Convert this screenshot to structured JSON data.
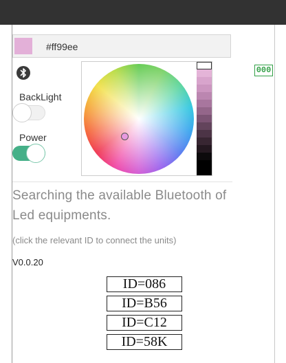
{
  "color": {
    "hex": "#ff99ee",
    "swatch_color": "#e3b0d8"
  },
  "bluetooth": {
    "icon": "bluetooth-icon"
  },
  "backlight": {
    "label": "BackLight",
    "on": false
  },
  "power": {
    "label": "Power",
    "on": true
  },
  "badge": {
    "text": "000",
    "color": "#32a046"
  },
  "ramp": [
    "#ffffff",
    "#e4b4d8",
    "#d8a4cc",
    "#cc96c0",
    "#bb86b0",
    "#a8769e",
    "#94668a",
    "#7c5474",
    "#63445c",
    "#4c3446",
    "#382632",
    "#241820",
    "#0c0a0c",
    "#000000"
  ],
  "status": {
    "searching": "Searching the available Bluetooth of Led equipments.",
    "hint": "(click the relevant ID to connect the units)",
    "version": "V0.0.20"
  },
  "devices": [
    {
      "label": "ID=086"
    },
    {
      "label": "ID=B56"
    },
    {
      "label": "ID=C12"
    },
    {
      "label": "ID=58K"
    }
  ]
}
